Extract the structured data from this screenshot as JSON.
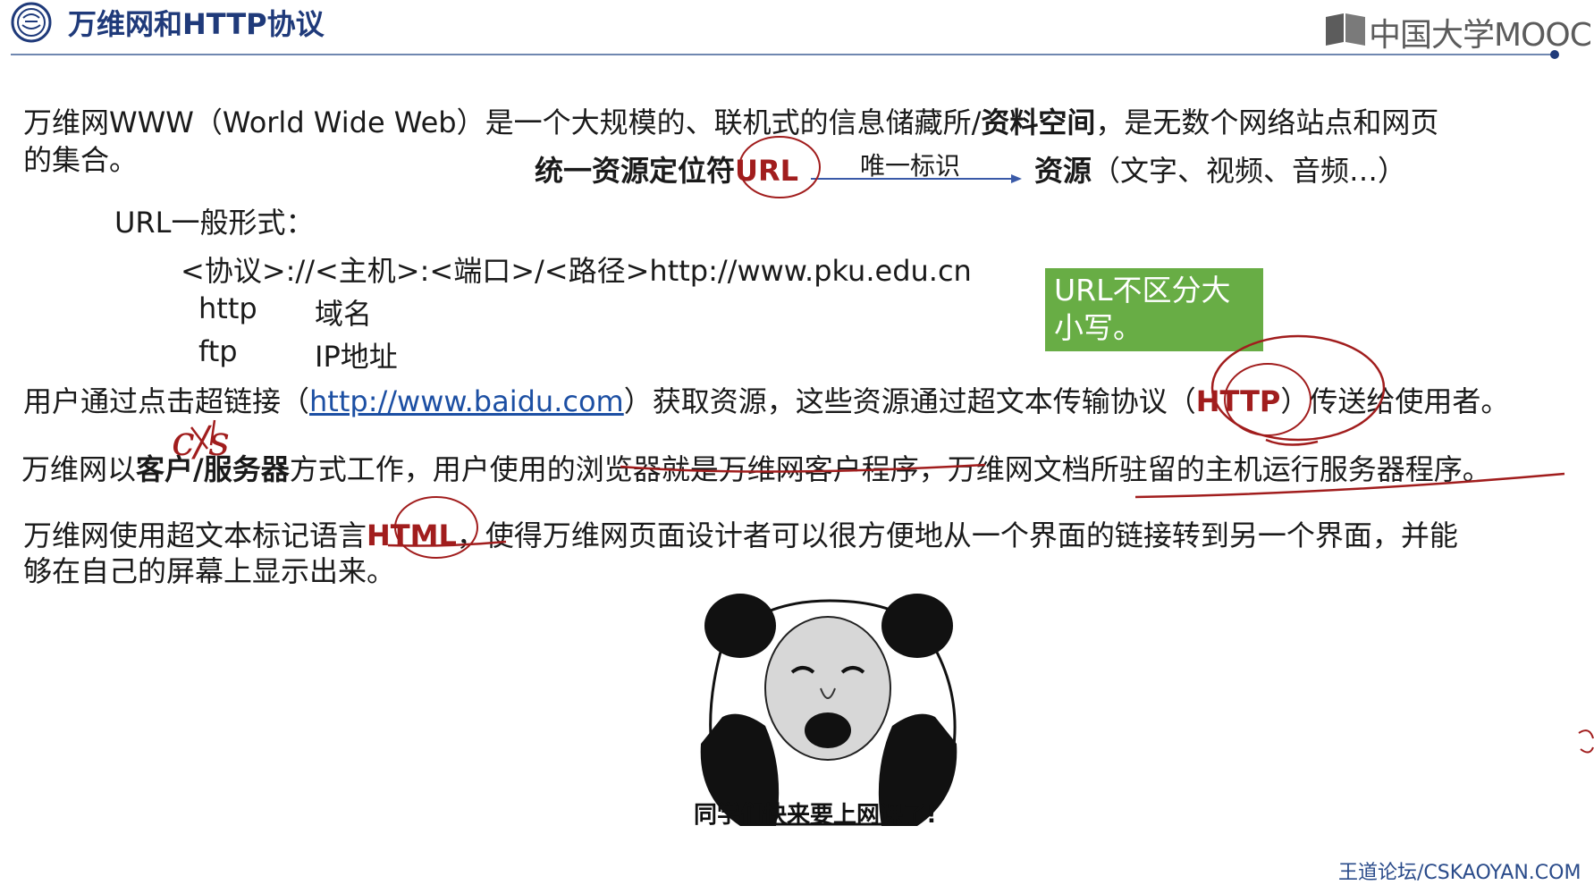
{
  "header": {
    "title": "万维网和HTTP协议",
    "brand": "中国大学MOOC"
  },
  "intro": {
    "prefix": "万维网WWW（World Wide Web）是一个大规模的、联机式的信息储藏所/",
    "bold": "资料空间",
    "suffix": "，是无数个网络站点和网页",
    "line2": "的集合。"
  },
  "url_diagram": {
    "left_bold": "统一资源定位符",
    "left_red": "URL",
    "arrow_label": "唯一标识",
    "right_bold": "资源",
    "right_rest": "（文字、视频、音频…）"
  },
  "url_form": {
    "heading": "URL一般形式：",
    "pattern": "<协议>://<主机>:<端口>/<路径>http://www.pku.edu.cn",
    "rows": [
      {
        "proto": "http",
        "host": "域名"
      },
      {
        "proto": "ftp",
        "host": "IP地址"
      }
    ]
  },
  "note_box": "URL不区分大小写。",
  "hyperlink_line": {
    "prefix": "用户通过点击超链接（",
    "link": "http://www.baidu.com",
    "middle": "）获取资源，这些资源通过超文本传输协议（",
    "red": "HTTP",
    "suffix": "）传送给使用者。"
  },
  "cs_line": {
    "prefix": "万维网以",
    "bold": "客户/服务器",
    "suffix": "方式工作，用户使用的浏览器就是万维网客户程序，万维网文档所驻留的主机运行服务器程序。"
  },
  "html_line": {
    "prefix": "万维网使用超文本标记语言",
    "red": "HTML",
    "suffix": "，使得万维网页面设计者可以很方便地从一个界面的链接转到另一个界面，并能",
    "line2": "够在自己的屏幕上显示出来。"
  },
  "handwriting": {
    "cs": "c/s"
  },
  "meme_caption": "同学们快来要上网课了!",
  "footer": "王道论坛/CSKAOYAN.COM",
  "colors": {
    "accent_red": "#a11d1d",
    "title_blue": "#1f3a7a",
    "note_green": "#68ad45",
    "link_blue": "#1c4fa3"
  }
}
